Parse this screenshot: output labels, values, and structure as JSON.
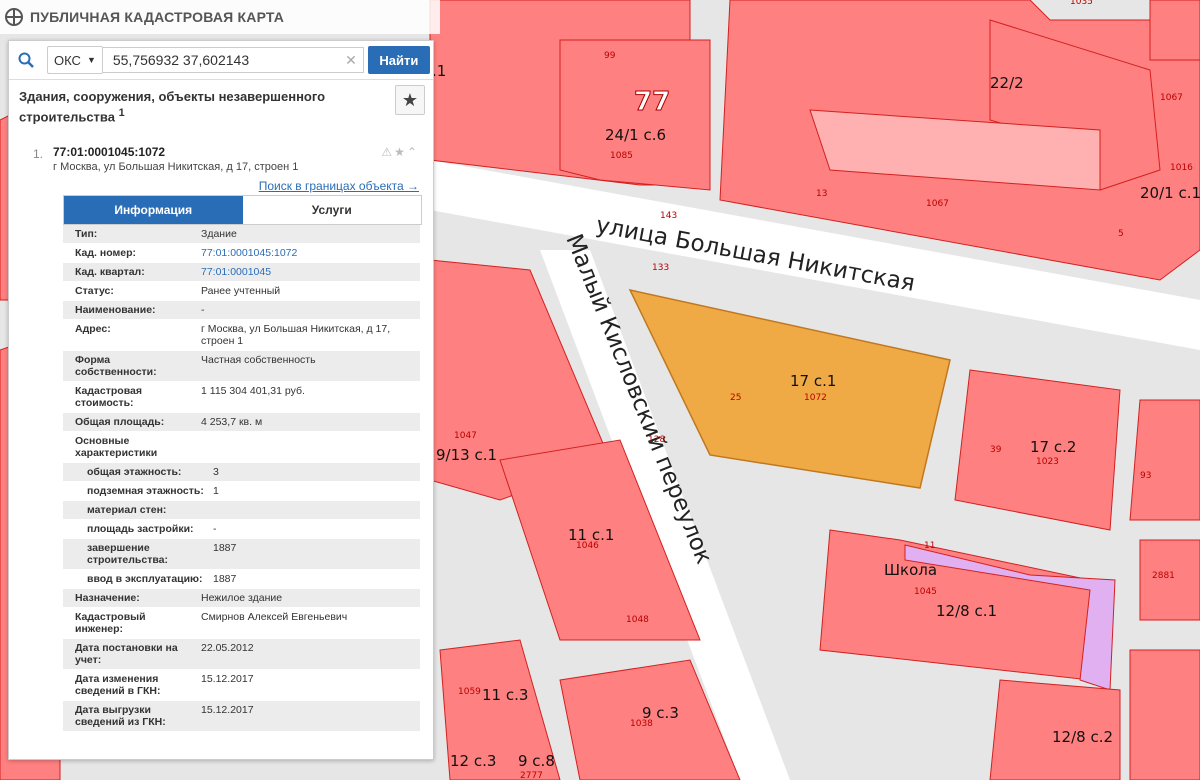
{
  "app": {
    "title": "ПУБЛИЧНАЯ КАДАСТРОВАЯ КАРТА"
  },
  "search": {
    "type": "ОКС",
    "value": "55,756932 37,602143",
    "button": "Найти"
  },
  "section_title": "Здания, сооружения, объекты незавершенного строительства",
  "section_count": "1",
  "result": {
    "index": "1.",
    "id": "77:01:0001045:1072",
    "address": "г Москва, ул Большая Никитская, д 17, строен 1",
    "search_link": "Поиск в границах объекта →"
  },
  "tabs": [
    {
      "label": "Информация"
    },
    {
      "label": "Услуги"
    }
  ],
  "properties": [
    {
      "k": "Тип:",
      "v": "Здание"
    },
    {
      "k": "Кад. номер:",
      "v": "77:01:0001045:1072"
    },
    {
      "k": "Кад. квартал:",
      "v": "77:01:0001045"
    },
    {
      "k": "Статус:",
      "v": "Ранее учтенный"
    },
    {
      "k": "Наименование:",
      "v": "-"
    },
    {
      "k": "Адрес:",
      "v": "г Москва, ул Большая Никитская, д 17, строен 1"
    },
    {
      "k": "Форма собственности:",
      "v": "Частная собственность"
    },
    {
      "k": "Кадастровая стоимость:",
      "v": "1 115 304 401,31 руб."
    },
    {
      "k": "Общая площадь:",
      "v": "4 253,7 кв. м"
    },
    {
      "k": "Основные характеристики",
      "v": ""
    },
    {
      "k": "общая этажность:",
      "v": "3"
    },
    {
      "k": "подземная этажность:",
      "v": "1"
    },
    {
      "k": "материал стен:",
      "v": ""
    },
    {
      "k": "площадь застройки:",
      "v": "-"
    },
    {
      "k": "завершение строительства:",
      "v": "1887"
    },
    {
      "k": "ввод в эксплуатацию:",
      "v": "1887"
    },
    {
      "k": "Назначение:",
      "v": "Нежилое здание"
    },
    {
      "k": "Кадастровый инженер:",
      "v": "Смирнов Алексей Евгеньевич"
    },
    {
      "k": "Дата постановки на учет:",
      "v": "22.05.2012"
    },
    {
      "k": "Дата изменения сведений в ГКН:",
      "v": "15.12.2017"
    },
    {
      "k": "Дата выгрузки сведений из ГКН:",
      "v": "15.12.2017"
    }
  ],
  "map": {
    "streets": {
      "main": "улица Большая Никитская",
      "side": "Малый Кисловский переулок"
    },
    "region": "77",
    "buildings": [
      "24/1 с.6",
      "22/2",
      "20/1 с.1",
      "17 с.1",
      "17 с.2",
      "9/13 с.1",
      "11 с.1",
      "Школа",
      "12/8 с.1",
      "11 с.3",
      "9 с.3",
      "12 с.3",
      "9 с.8",
      "12/8 с.2",
      ".1"
    ],
    "cadastral": [
      "99",
      "1085",
      "13",
      "1067",
      "143",
      "133",
      "25",
      "1072",
      "128",
      "1047",
      "39",
      "1023",
      "93",
      "11",
      "1045",
      "1046",
      "1048",
      "1059",
      "1038",
      "2777",
      "2881",
      "1016",
      "5",
      "1067",
      "1035"
    ],
    "colors": {
      "parcel": "#ff8080",
      "parcel_border": "#d42020",
      "selected": "#f0aa45",
      "school_zone": "#e0b0f0",
      "road": "#ffffff",
      "ground": "#e6e6e6"
    }
  }
}
